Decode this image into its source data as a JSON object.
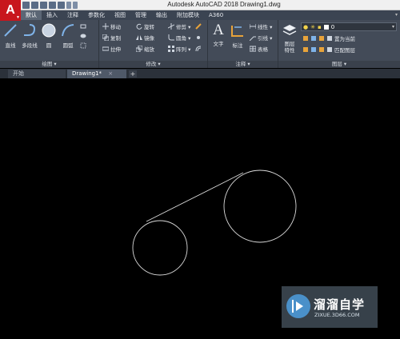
{
  "app": {
    "logo_letter": "A",
    "window_title": "Autodesk AutoCAD 2018    Drawing1.dwg"
  },
  "ribbon_tabs": [
    {
      "label": "默认",
      "active": true
    },
    {
      "label": "插入"
    },
    {
      "label": "注释"
    },
    {
      "label": "参数化"
    },
    {
      "label": "视图"
    },
    {
      "label": "管理"
    },
    {
      "label": "输出"
    },
    {
      "label": "附加模块"
    },
    {
      "label": "A360"
    }
  ],
  "panels": {
    "draw": {
      "title": "绘图 ▾",
      "tools": {
        "line": "直线",
        "polyline": "多段线",
        "circle": "圆",
        "arc": "圆弧"
      }
    },
    "modify": {
      "title": "修改 ▾",
      "tools": {
        "move": "移动",
        "rotate": "旋转",
        "trim": "修剪 ▾",
        "copy": "复制",
        "mirror": "镜像",
        "fillet": "圆角 ▾",
        "stretch": "拉伸",
        "scale": "缩放",
        "array": "阵列 ▾"
      }
    },
    "annotation": {
      "title": "注释 ▾",
      "tools": {
        "text": "文字",
        "dimension": "标注",
        "linear": "线性 ▾",
        "leader": "引线 ▾",
        "table": "表格"
      }
    },
    "layers": {
      "title": "图层 ▾",
      "tools": {
        "layer_properties": "图层\n特性",
        "layer_value": "0",
        "make_current": "置为当前",
        "match_layer": "匹配图层"
      }
    }
  },
  "file_tabs": [
    {
      "label": "开始"
    },
    {
      "label": "Drawing1*",
      "active": true,
      "close": "×"
    }
  ],
  "file_tab_add": "+",
  "watermark": {
    "title": "溜溜自学",
    "subtitle": "ZIXUE.3D66.COM"
  },
  "colors": {
    "canvas": "#000000",
    "geometry": "#d9d9d9",
    "logo_red": "#c8161d",
    "ribbon": "#434b58"
  }
}
